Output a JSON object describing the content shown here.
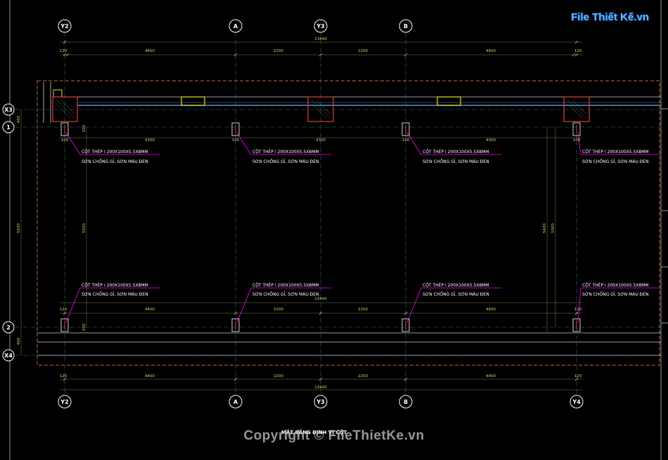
{
  "logo": {
    "text": "File Thiết Kế.vn"
  },
  "watermark": "Copyright © FileThietKe.vn",
  "drawing_title": "MẶT BẰNG ĐỊNH VỊ CỘT",
  "top_axes": [
    "Y2",
    "A",
    "Y3",
    "B"
  ],
  "bottom_axes": [
    "Y2",
    "A",
    "Y3",
    "B",
    "Y4"
  ],
  "left_axes": [
    "X3",
    "1",
    "2",
    "X4"
  ],
  "top_dims": [
    "120",
    "4400",
    "2200",
    "2200",
    "4400",
    "120"
  ],
  "top_total": "13440",
  "inner_top_dims": [
    "4300",
    "4300",
    "4300"
  ],
  "col_dims": [
    "100",
    "100",
    "100",
    "100"
  ],
  "mid_dims": [
    "120",
    "4400",
    "2200",
    "2200",
    "4400",
    "120"
  ],
  "mid_total": "13440",
  "bottom_dims": [
    "120",
    "4400",
    "2200",
    "2200",
    "4400",
    "120"
  ],
  "bottom_total": "13440",
  "left_vdims": [
    "400",
    "5200",
    "400"
  ],
  "inner_vdim": "5000",
  "right_vdims": [
    "5400",
    "5000"
  ],
  "small_dims": [
    "200",
    "200"
  ],
  "note_line1": "CỘT THÉP I 200X100X5.5X8MM",
  "note_line2": "SƠN CHỐNG GỈ, SƠN MÀU ĐEN",
  "colors": {
    "axis": "#ffffff",
    "grid": "#2f6f6f",
    "dim": "#d8d070",
    "leader": "#ff00ff",
    "column": "#e04040",
    "boundary": "#c06a3a",
    "beam": "#5a90c8",
    "window": "#e8e020"
  }
}
